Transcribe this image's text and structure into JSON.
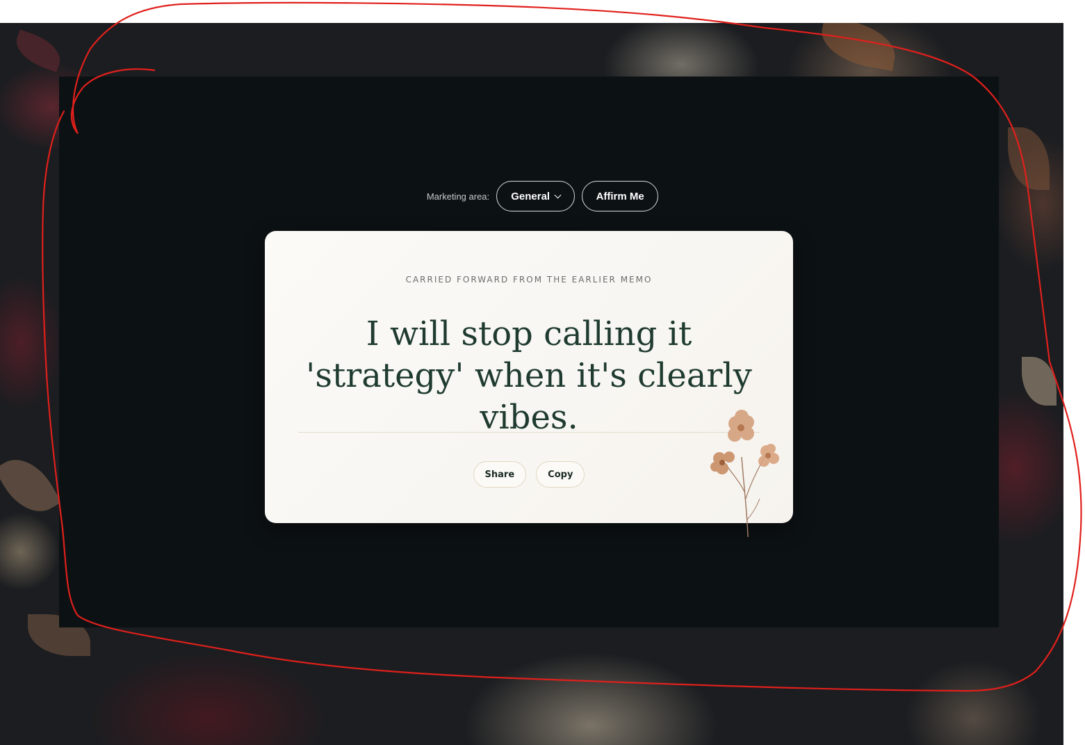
{
  "controls": {
    "area_label": "Marketing area:",
    "area_selected": "General",
    "affirm_label": "Affirm Me"
  },
  "card": {
    "eyebrow": "CARRIED FORWARD FROM THE EARLIER MEMO",
    "quote": "I will stop calling it 'strategy' when it's clearly vibes.",
    "share_label": "Share",
    "copy_label": "Copy"
  },
  "icons": {
    "dropdown": "chevron-down-icon",
    "decoration": "dried-flower-illustration"
  },
  "colors": {
    "panel": "#0c1113",
    "card": "#fbfaf7",
    "quote_text": "#1f3b30",
    "annotation": "#e0201c"
  }
}
